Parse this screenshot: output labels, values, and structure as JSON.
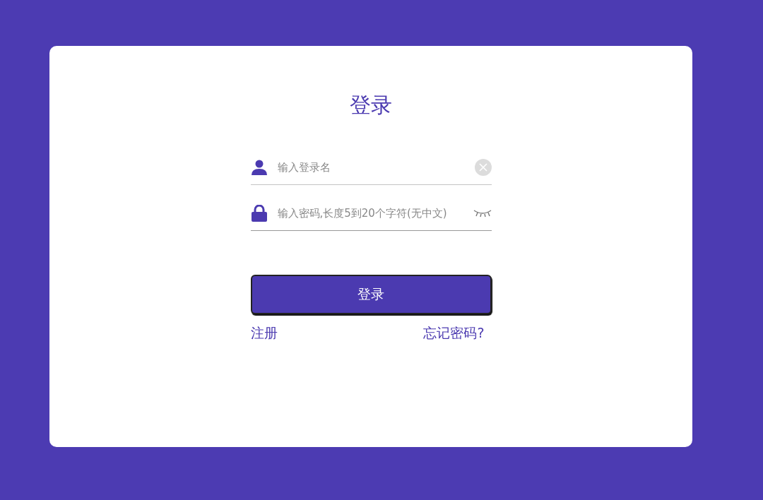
{
  "title": "登录",
  "fields": [
    {
      "kind": "user",
      "placeholder": "输入登录名"
    },
    {
      "kind": "password",
      "placeholder": "输入密码,长度5到20个字符(无中文)"
    }
  ],
  "submit": "登录",
  "links": [
    "注册",
    "忘记密码?"
  ]
}
